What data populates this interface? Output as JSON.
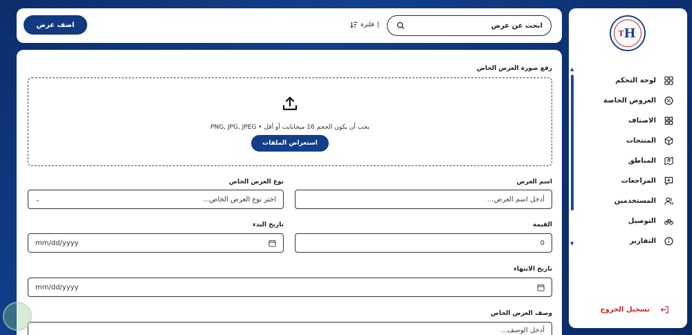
{
  "brand": {
    "logo_text": "H",
    "logo_sub": "T"
  },
  "sidebar": {
    "items": [
      {
        "label": "لوحة التحكم",
        "icon": "grid-icon"
      },
      {
        "label": "العروض الخاصة",
        "icon": "percent-badge-icon"
      },
      {
        "label": "الاصناف",
        "icon": "categories-icon"
      },
      {
        "label": "المنتجات",
        "icon": "box-icon"
      },
      {
        "label": "المناطق",
        "icon": "map-icon"
      },
      {
        "label": "المراجعات",
        "icon": "review-icon"
      },
      {
        "label": "المستخدمين",
        "icon": "users-icon"
      },
      {
        "label": "التوصيل",
        "icon": "bicycle-icon"
      },
      {
        "label": "التقارير",
        "icon": "info-icon"
      }
    ],
    "logout_label": "تسجيل الخروج"
  },
  "topbar": {
    "search_placeholder": "ابحث عن عرض",
    "filter_label": "فلترة",
    "add_button": "اضف عرض"
  },
  "form": {
    "upload_label": "رفع صورة العرض الخاص",
    "upload_hint": "يجب أن يكون الحجم 16 ميجابايت أو أقل • PNG, JPG, JPEG",
    "browse_button": "استعراض الملفات",
    "offer_name_label": "اسم العرض",
    "offer_name_placeholder": "أدخل اسم العرض...",
    "offer_type_label": "نوع العرض الخاص",
    "offer_type_selected": "اختر نوع العرض الخاص...",
    "value_label": "القيمة",
    "value_value": "0",
    "start_date_label": "تاريخ البدء",
    "start_date_value": "mm/dd/yyyy",
    "end_date_label": "تاريخ الانتهاء",
    "end_date_value": "mm/dd/yyyy",
    "description_label": "وصف العرض الخاص",
    "description_placeholder": "أدخل الوصف..."
  },
  "colors": {
    "primary": "#123f8c",
    "danger": "#c62828",
    "background": "#0b2d6b"
  }
}
